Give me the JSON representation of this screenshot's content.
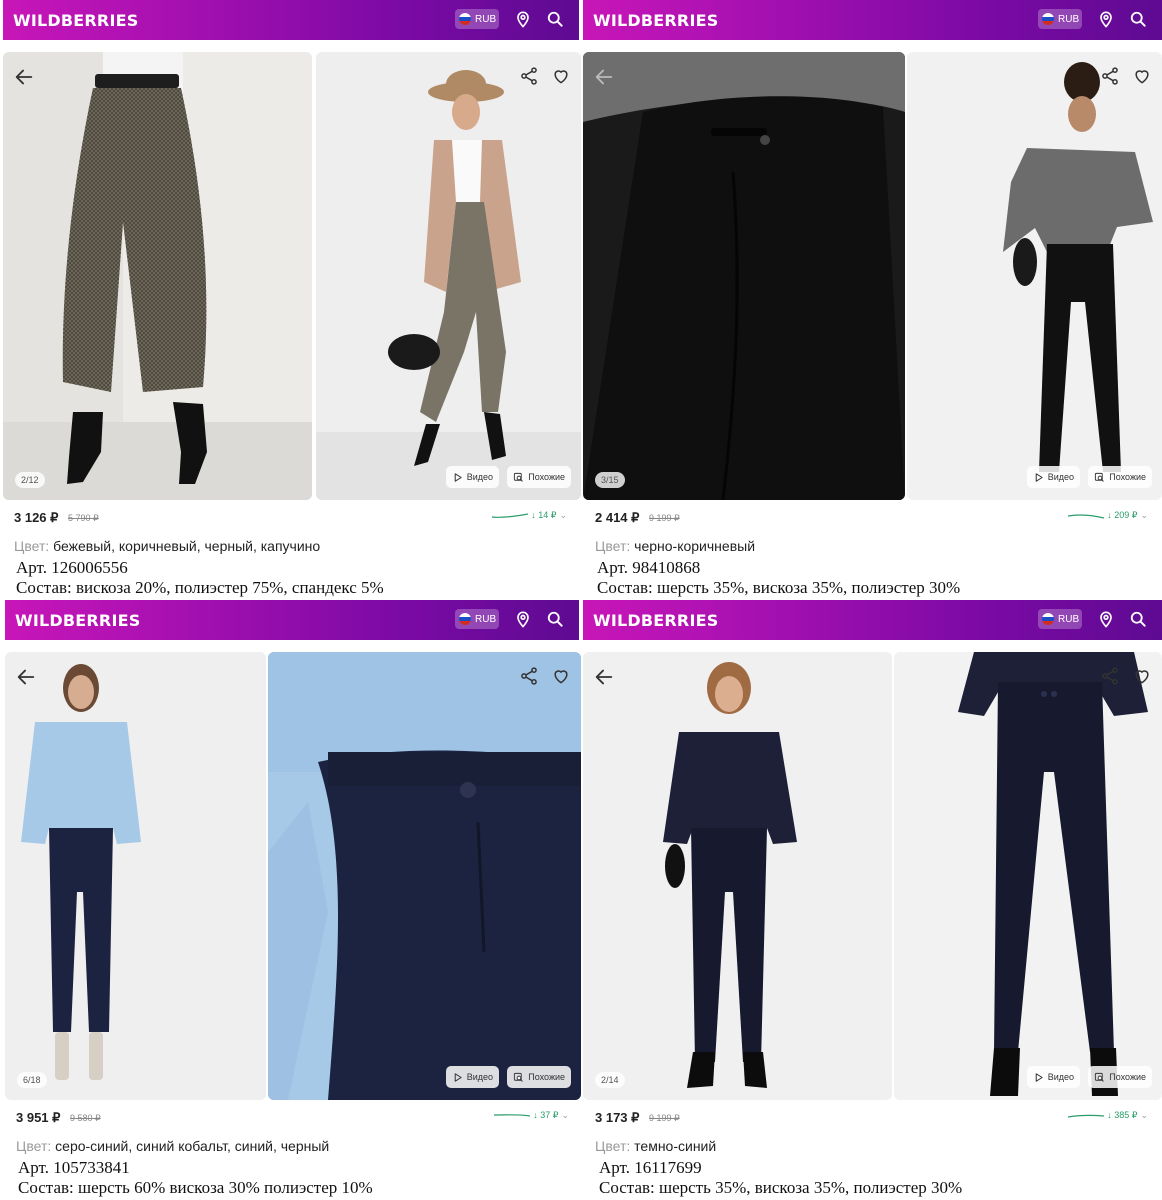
{
  "header": {
    "logo": "WILDBERRIES",
    "currency": "RUB",
    "accent_gradient": [
      "#c816b8",
      "#5e0a92"
    ]
  },
  "icons": [
    "back-arrow-icon",
    "share-icon",
    "heart-icon",
    "location-pin-icon",
    "search-icon",
    "play-icon",
    "similar-icon"
  ],
  "labels": {
    "color": "Цвет:",
    "video": "Видео",
    "similar": "Похожие"
  },
  "products": [
    {
      "image_counter": "2/12",
      "price": "3 126 ₽",
      "old_price": "5 790 ₽",
      "price_change": "↓ 14 ₽",
      "color": "бежевый, коричневый, черный, капучино",
      "article": "Арт. 126006556",
      "composition": "Состав: вискоза 20%, полиэстер 75%, спандекс 5%"
    },
    {
      "image_counter": "3/15",
      "price": "2 414 ₽",
      "old_price": "9 199 ₽",
      "price_change": "↓ 209 ₽",
      "color": "черно-коричневый",
      "article": "Арт. 98410868",
      "composition": "Состав: шерсть 35%, вискоза 35%, полиэстер 30%"
    },
    {
      "image_counter": "6/18",
      "price": "3 951 ₽",
      "old_price": "9 580 ₽",
      "price_change": "↓ 37 ₽",
      "color": "серо-синий, синий кобальт, синий, черный",
      "article": "Арт. 105733841",
      "composition": "Состав: шерсть 60% вискоза 30% полиэстер 10%"
    },
    {
      "image_counter": "2/14",
      "price": "3 173 ₽",
      "old_price": "9 199 ₽",
      "price_change": "↓ 385 ₽",
      "color": "темно-синий",
      "article": "Арт. 16117699",
      "composition": "Состав: шерсть 35%, вискоза 35%, полиэстер 30%"
    }
  ]
}
